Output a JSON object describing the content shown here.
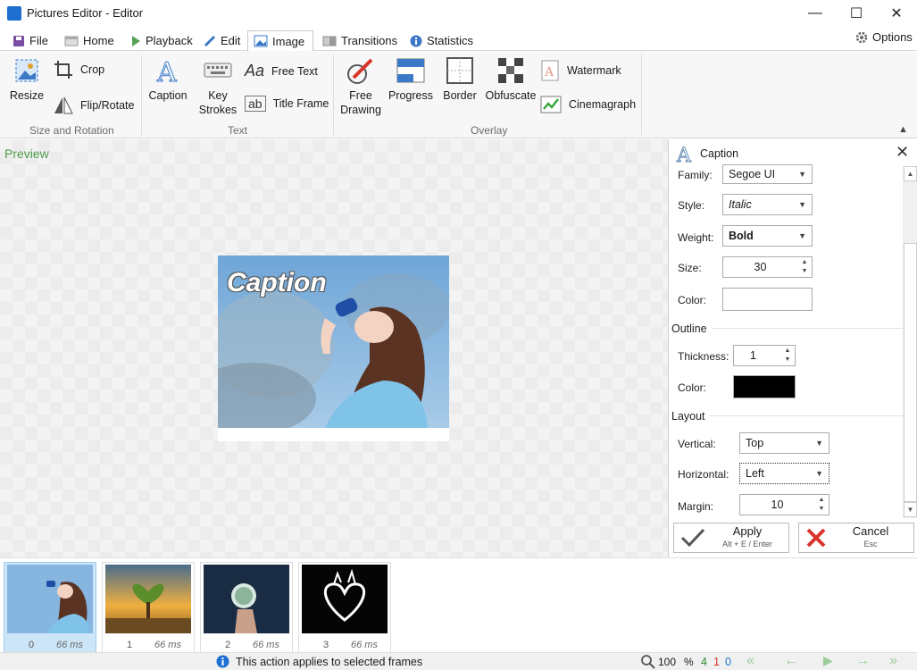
{
  "window": {
    "title": "Pictures Editor - Editor",
    "minimize": "—",
    "maximize": "☐",
    "close": "✕"
  },
  "tabs": [
    {
      "label": "File",
      "icon": "save-icon"
    },
    {
      "label": "Home",
      "icon": "home-icon"
    },
    {
      "label": "Playback",
      "icon": "play-icon"
    },
    {
      "label": "Edit",
      "icon": "pencil-icon"
    },
    {
      "label": "Image",
      "icon": "image-icon",
      "active": true
    },
    {
      "label": "Transitions",
      "icon": "transitions-icon"
    },
    {
      "label": "Statistics",
      "icon": "info-icon"
    }
  ],
  "options_label": "Options",
  "ribbon": {
    "size_rotation": {
      "label": "Size and Rotation",
      "resize": "Resize",
      "crop": "Crop",
      "flip_rotate": "Flip/Rotate"
    },
    "text": {
      "label": "Text",
      "caption": "Caption",
      "key_strokes_1": "Key",
      "key_strokes_2": "Strokes",
      "free_text": "Free Text",
      "title_frame": "Title Frame",
      "free_text_glyph": "Aa",
      "title_frame_glyph": "ab"
    },
    "overlay": {
      "label": "Overlay",
      "free_drawing_1": "Free",
      "free_drawing_2": "Drawing",
      "progress": "Progress",
      "border": "Border",
      "obfuscate": "Obfuscate",
      "watermark": "Watermark",
      "cinemagraph": "Cinemagraph"
    }
  },
  "preview": {
    "label": "Preview",
    "caption_text": "Caption"
  },
  "panel": {
    "title": "Caption",
    "font": {
      "family_label": "Family:",
      "family_value": "Segoe UI",
      "style_label": "Style:",
      "style_value": "Italic",
      "weight_label": "Weight:",
      "weight_value": "Bold",
      "size_label": "Size:",
      "size_value": "30",
      "color_label": "Color:",
      "color_value": "#FFFFFF"
    },
    "outline": {
      "section": "Outline",
      "thickness_label": "Thickness:",
      "thickness_value": "1",
      "color_label": "Color:",
      "color_value": "#000000"
    },
    "layout": {
      "section": "Layout",
      "vertical_label": "Vertical:",
      "vertical_value": "Top",
      "horizontal_label": "Horizontal:",
      "horizontal_value": "Left",
      "margin_label": "Margin:",
      "margin_value": "10"
    },
    "apply": {
      "label": "Apply",
      "shortcut": "Alt + E / Enter"
    },
    "cancel": {
      "label": "Cancel",
      "shortcut": "Esc"
    }
  },
  "frames": [
    {
      "index": "0",
      "delay": "66 ms",
      "selected": true
    },
    {
      "index": "1",
      "delay": "66 ms"
    },
    {
      "index": "2",
      "delay": "66 ms"
    },
    {
      "index": "3",
      "delay": "66 ms"
    }
  ],
  "status": {
    "message": "This action applies to selected frames",
    "zoom": "100",
    "zoom_unit": "%",
    "count_total": "4",
    "count_selected": "1",
    "count_deleted": "0"
  },
  "colors": {
    "accent": "#1e6fd0",
    "green": "#2e8b2e",
    "red": "#d9342b"
  }
}
